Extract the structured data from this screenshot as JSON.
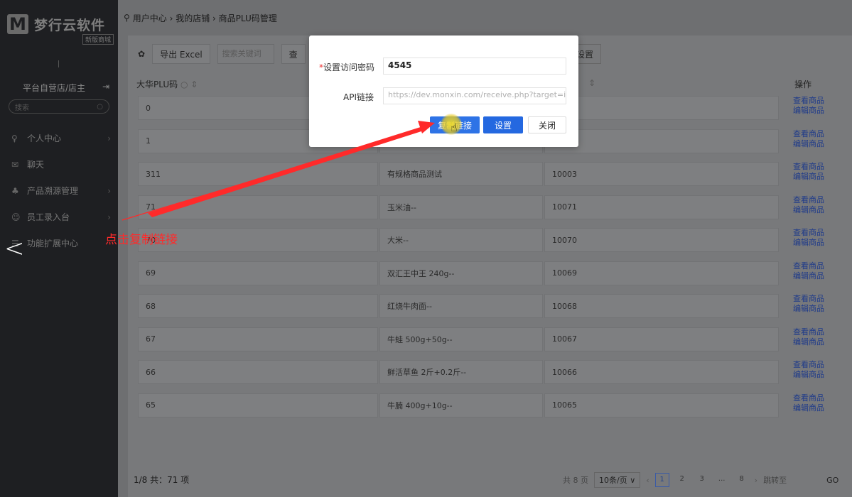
{
  "sidebar": {
    "logo_mark": "M",
    "logo_text": "梦行云软件",
    "logo_badge": "新版商城",
    "store_label": "平台自营店/店主",
    "search_placeholder": "搜索",
    "menu": [
      {
        "icon": "user-icon",
        "glyph": "♀",
        "label": "个人中心"
      },
      {
        "icon": "chat-icon",
        "glyph": "✉",
        "label": "聊天"
      },
      {
        "icon": "product-icon",
        "glyph": "♣",
        "label": "产品溯源管理"
      },
      {
        "icon": "staff-icon",
        "glyph": "☺",
        "label": "员工录入台"
      },
      {
        "icon": "extension-icon",
        "glyph": "☰",
        "label": "功能扩展中心"
      }
    ],
    "collapse_glyph": "<"
  },
  "breadcrumb": "用户中心 › 我的店铺 › 商品PLU码管理",
  "toolbar": {
    "export_label": "导出 Excel",
    "search_placeholder": "搜索关键词",
    "query_label": "查",
    "set_label": "设置"
  },
  "table": {
    "col1": "大华PLU码",
    "col_action": "操作",
    "rows": [
      {
        "plu": "0",
        "name": "",
        "code": ""
      },
      {
        "plu": "1",
        "name": "",
        "code": ""
      },
      {
        "plu": "311",
        "name": "有规格商品测试",
        "code": "10003"
      },
      {
        "plu": "71",
        "name": "玉米油--",
        "code": "10071"
      },
      {
        "plu": "70",
        "name": "大米--",
        "code": "10070"
      },
      {
        "plu": "69",
        "name": "双汇王中王 240g--",
        "code": "10069"
      },
      {
        "plu": "68",
        "name": "红烧牛肉面--",
        "code": "10068"
      },
      {
        "plu": "67",
        "name": "牛蛙 500g+50g--",
        "code": "10067"
      },
      {
        "plu": "66",
        "name": "鲜活草鱼 2斤+0.2斤--",
        "code": "10066"
      },
      {
        "plu": "65",
        "name": "牛腩 400g+10g--",
        "code": "10065"
      }
    ],
    "action_view": "查看商品",
    "action_edit": "编辑商品"
  },
  "footer": {
    "summary": "1/8 共：71 项",
    "total_pages": "共 8 页",
    "per_page": "10条/页 ∨",
    "pages": [
      "1",
      "2",
      "3",
      "...",
      "8"
    ],
    "jump_label": "跳转至",
    "go": "GO"
  },
  "modal": {
    "password_label": "设置访问密码",
    "password_value": "4545",
    "api_label": "API链接",
    "api_value": "https://dev.monxin.com/receive.php?target=ind",
    "copy_button": "复制链接",
    "set_button": "设置",
    "close_button": "关闭"
  },
  "annotation": {
    "text": "点击复制链接",
    "color": "#ff2a2a"
  }
}
